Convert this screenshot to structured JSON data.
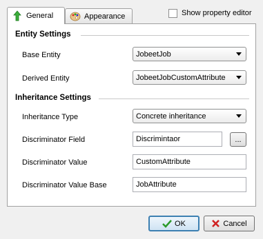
{
  "tabs": [
    {
      "label": "General",
      "icon": "green-arrow-icon",
      "active": true
    },
    {
      "label": "Appearance",
      "icon": "palette-icon",
      "active": false
    }
  ],
  "show_property_editor": {
    "label": "Show property editor",
    "checked": false
  },
  "entity_settings": {
    "title": "Entity Settings",
    "base_entity_label": "Base Entity",
    "base_entity_value": "JobeetJob",
    "derived_entity_label": "Derived Entity",
    "derived_entity_value": "JobeetJobCustomAttribute"
  },
  "inheritance_settings": {
    "title": "Inheritance Settings",
    "type_label": "Inheritance Type",
    "type_value": "Concrete inheritance",
    "discriminator_field_label": "Discriminator Field",
    "discriminator_field_value": "Discrimintaor",
    "browse_label": "...",
    "discriminator_value_label": "Discriminator Value",
    "discriminator_value_value": "CustomAttribute",
    "discriminator_value_base_label": "Discriminator Value Base",
    "discriminator_value_base_value": "JobAttribute"
  },
  "buttons": {
    "ok": "OK",
    "cancel": "Cancel"
  },
  "colors": {
    "ok_border": "#3c7fb1",
    "check_green": "#2a9a2a",
    "cancel_red": "#d02020"
  }
}
